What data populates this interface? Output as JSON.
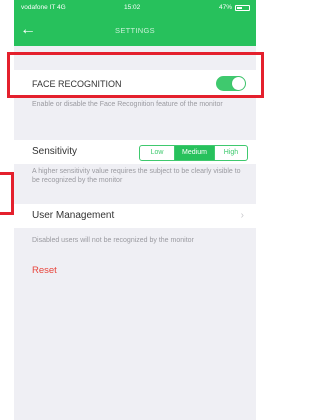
{
  "status_bar": {
    "carrier": "vodafone IT  4G",
    "time": "15:02",
    "battery": "47%"
  },
  "nav": {
    "title": "SETTINGS"
  },
  "face_recognition": {
    "label": "FACE RECOGNITION",
    "enabled": true,
    "description": "Enable or disable the Face Recognition feature of the monitor"
  },
  "sensitivity": {
    "label": "Sensitivity",
    "options": [
      "Low",
      "Medium",
      "High"
    ],
    "selected": "Medium",
    "description": "A higher sensitivity value requires the subject to be clearly visible to be recognized by the monitor"
  },
  "user_management": {
    "label": "User Management",
    "description": "Disabled users will not be recognized by the monitor"
  },
  "reset": {
    "label": "Reset"
  },
  "colors": {
    "accent": "#27c15c",
    "reset": "#e8453c",
    "annotation": "#e4202d"
  }
}
